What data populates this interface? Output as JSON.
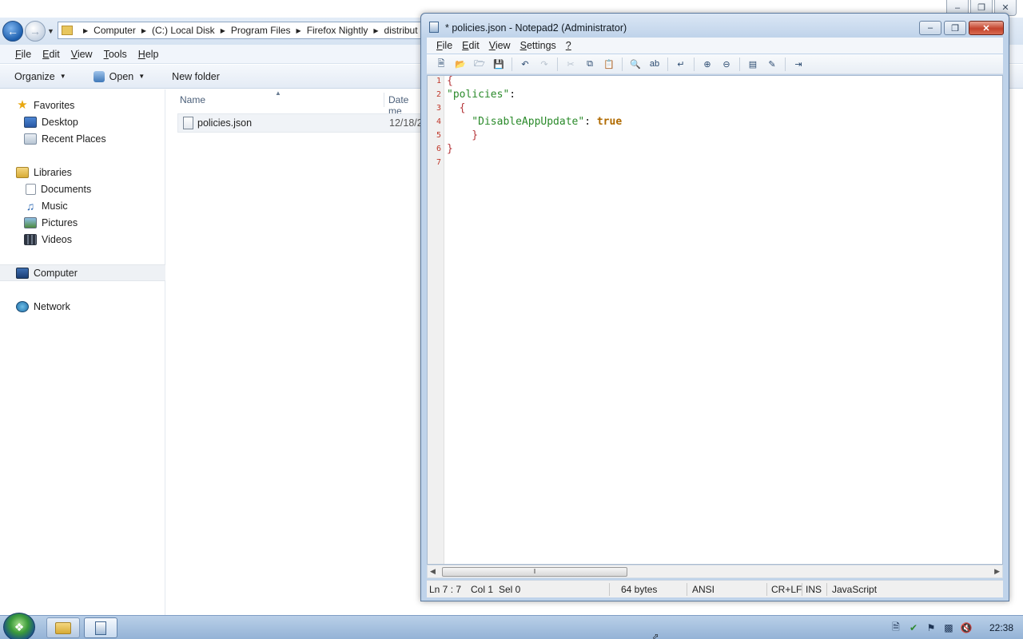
{
  "explorer": {
    "breadcrumbs": [
      "Computer",
      "(C:) Local Disk",
      "Program Files",
      "Firefox Nightly",
      "distribut"
    ],
    "menu": {
      "file": {
        "accel": "F",
        "rest": "ile"
      },
      "edit": {
        "accel": "E",
        "rest": "dit"
      },
      "view": {
        "accel": "V",
        "rest": "iew"
      },
      "tools": {
        "accel": "T",
        "rest": "ools"
      },
      "help": {
        "accel": "H",
        "rest": "elp"
      }
    },
    "toolbar": {
      "organize": "Organize",
      "open": "Open",
      "new_folder": "New folder"
    },
    "nav": {
      "favorites": "Favorites",
      "desktop": "Desktop",
      "recent_places": "Recent Places",
      "libraries": "Libraries",
      "documents": "Documents",
      "music": "Music",
      "pictures": "Pictures",
      "videos": "Videos",
      "computer": "Computer",
      "network": "Network"
    },
    "columns": {
      "name": "Name",
      "date": "Date me"
    },
    "files": [
      {
        "name": "policies.json",
        "date": "12/18/2"
      }
    ]
  },
  "notepad": {
    "title": "* policies.json - Notepad2 (Administrator)",
    "menu": {
      "file": {
        "accel": "F",
        "rest": "ile"
      },
      "edit": {
        "accel": "E",
        "rest": "dit"
      },
      "view": {
        "accel": "V",
        "rest": "iew"
      },
      "settings": {
        "accel": "S",
        "rest": "ettings"
      },
      "help": {
        "accel": "?",
        "rest": ""
      }
    },
    "line_numbers": [
      "1",
      "2",
      "3",
      "4",
      "5",
      "6",
      "7"
    ],
    "code": {
      "l1": "{",
      "l2_key": "\"policies\"",
      "l2_punct": ":",
      "l3": "  {",
      "l4_key": "    \"DisableAppUpdate\"",
      "l4_punct": ": ",
      "l4_value": "true",
      "l5": "    }",
      "l6": "}"
    },
    "status": {
      "position": "Ln 7 : 7",
      "col": "Col 1",
      "sel": "Sel 0",
      "size": "64 bytes",
      "encoding": "ANSI",
      "line_endings": "CR+LF",
      "mode": "INS",
      "language": "JavaScript"
    },
    "toolbar_icons": [
      "new-file-icon",
      "open-file-icon",
      "browse-icon",
      "save-icon",
      "undo-icon",
      "redo-icon",
      "cut-icon",
      "copy-icon",
      "paste-icon",
      "find-icon",
      "replace-icon",
      "word-wrap-icon",
      "zoom-in-icon",
      "zoom-out-icon",
      "scheme-icon",
      "customize-icon",
      "exit-icon"
    ]
  },
  "taskbar": {
    "clock": "22:38",
    "tray_icons": [
      "action-center-icon",
      "security-icon",
      "flag-icon",
      "network-icon",
      "volume-muted-icon"
    ]
  },
  "colors": {
    "line_number": "#c0392b",
    "json_key": "#2a8a2a",
    "json_brace": "#b5373b",
    "json_bool": "#b06a00"
  }
}
